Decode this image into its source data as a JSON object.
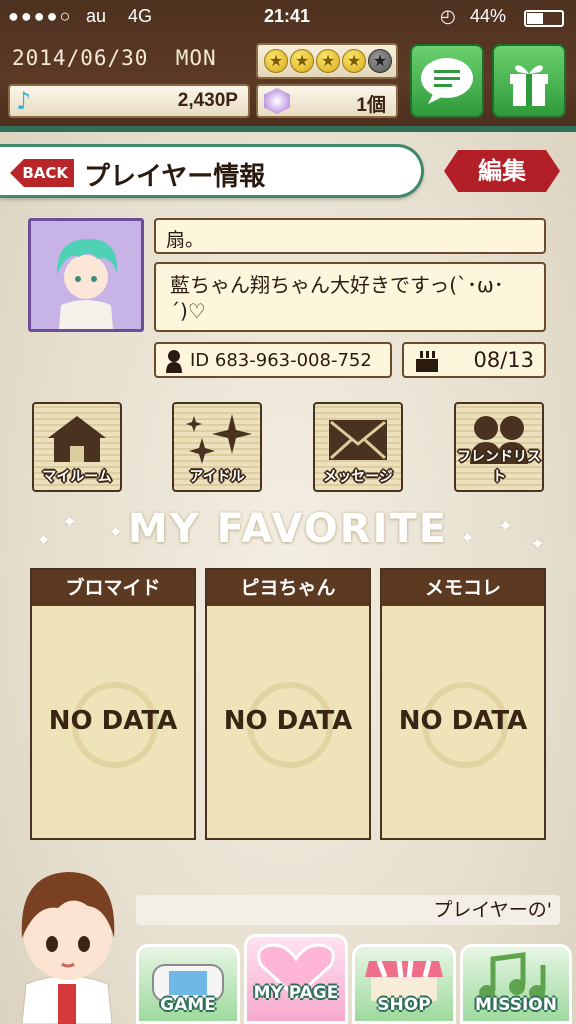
{
  "status_bar": {
    "carrier": "au",
    "network": "4G",
    "time": "21:41",
    "battery": "44%"
  },
  "top": {
    "date": "2014/06/30",
    "weekday": "MON",
    "stars_filled": 4,
    "stars_total": 5,
    "points": "2,430P",
    "items": "1個"
  },
  "header": {
    "back_label": "BACK",
    "title": "プレイヤー情報",
    "edit_label": "編集"
  },
  "profile": {
    "name": "扇。",
    "message": "藍ちゃん翔ちゃん大好きですっ(`･ω･´)♡",
    "id_text": "ID 683-963-008-752",
    "birthday": "08/13"
  },
  "menu": [
    {
      "label": "マイルーム"
    },
    {
      "label": "アイドル"
    },
    {
      "label": "メッセージ"
    },
    {
      "label": "フレンドリスト"
    }
  ],
  "favorite": {
    "heading": "MY FAVORITE",
    "cards": [
      {
        "title": "ブロマイド",
        "empty": "NO DATA"
      },
      {
        "title": "ピヨちゃん",
        "empty": "NO DATA"
      },
      {
        "title": "メモコレ",
        "empty": "NO DATA"
      }
    ]
  },
  "chat_text": "プレイヤーの'",
  "nav": [
    {
      "label": "GAME"
    },
    {
      "label": "MY PAGE"
    },
    {
      "label": "SHOP"
    },
    {
      "label": "MISSION"
    }
  ]
}
